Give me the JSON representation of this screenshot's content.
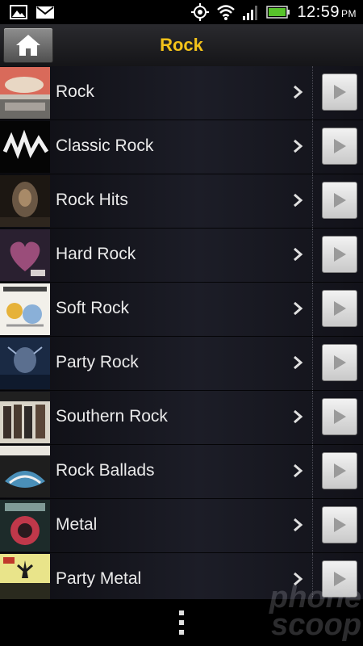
{
  "status_bar": {
    "time": "12:59",
    "ampm": "PM",
    "icons": [
      "gallery-icon",
      "gmail-icon",
      "gps-icon",
      "wifi-icon",
      "signal-icon",
      "battery-icon"
    ]
  },
  "header": {
    "title": "Rock",
    "home_icon": "home-icon"
  },
  "genres": [
    {
      "label": "Rock"
    },
    {
      "label": "Classic Rock"
    },
    {
      "label": "Rock Hits"
    },
    {
      "label": "Hard Rock"
    },
    {
      "label": "Soft Rock"
    },
    {
      "label": "Party Rock"
    },
    {
      "label": "Southern Rock"
    },
    {
      "label": "Rock Ballads"
    },
    {
      "label": "Metal"
    },
    {
      "label": "Party Metal"
    }
  ],
  "bottom_bar": {
    "menu_icon": "overflow-menu-icon"
  },
  "watermark": {
    "line1": "phone",
    "line2": "scoop"
  },
  "colors": {
    "title": "#f3c21a",
    "label": "#eaeaea"
  }
}
